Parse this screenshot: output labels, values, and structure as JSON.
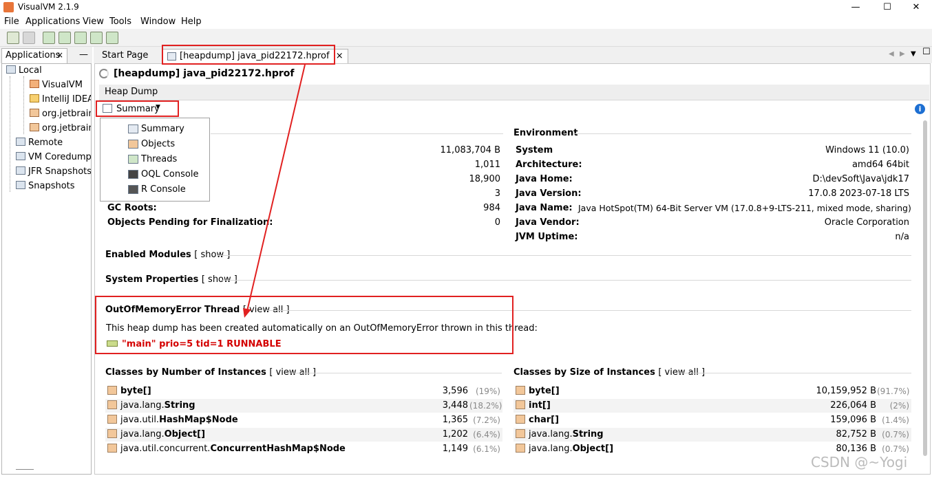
{
  "window": {
    "title": "VisualVM 2.1.9",
    "min": "—",
    "max": "☐",
    "close": "✕"
  },
  "menu": [
    "File",
    "Applications",
    "View",
    "Tools",
    "Window",
    "Help"
  ],
  "left_panel": {
    "tab_label": "Applications",
    "close": "×",
    "minimize": "—",
    "tree": {
      "local": "Local",
      "local_children": [
        "VisualVM",
        "IntelliJ IDEA",
        "org.jetbrains",
        "org.jetbrains"
      ],
      "remote": "Remote",
      "vm_coredumps": "VM Coredumps",
      "jfr_snapshots": "JFR Snapshots",
      "snapshots": "Snapshots"
    }
  },
  "editor_tabs": {
    "start_page": "Start Page",
    "heapdump_tab": "[heapdump] java_pid22172.hprof",
    "close": "×"
  },
  "heapdump": {
    "heading": "[heapdump] java_pid22172.hprof",
    "subheader": "Heap Dump",
    "view_selector": "Summary",
    "info": "i",
    "dropdown": [
      "Summary",
      "Objects",
      "Threads",
      "OQL Console",
      "R Console"
    ]
  },
  "basic_info": {
    "values": [
      "11,083,704 B",
      "1,011",
      "18,900",
      "3"
    ],
    "gc_roots_label": "GC Roots:",
    "gc_roots_value": "984",
    "pending_label": "Objects Pending for Finalization:",
    "pending_value": "0"
  },
  "environment": {
    "title": "Environment",
    "rows": [
      {
        "label": "System",
        "value": "Windows 11 (10.0)"
      },
      {
        "label": "Architecture:",
        "value": "amd64 64bit"
      },
      {
        "label": "Java Home:",
        "value": "D:\\devSoft\\Java\\jdk17"
      },
      {
        "label": "Java Version:",
        "value": "17.0.8 2023-07-18 LTS"
      },
      {
        "label": "Java Name:",
        "value": "Java HotSpot(TM) 64-Bit Server VM (17.0.8+9-LTS-211, mixed mode, sharing)"
      },
      {
        "label": "Java Vendor:",
        "value": "Oracle Corporation"
      },
      {
        "label": "JVM Uptime:",
        "value": "n/a"
      }
    ]
  },
  "sections": {
    "enabled_modules": "Enabled Modules",
    "system_properties": "System Properties",
    "show": "[ show ]",
    "oom_thread": "OutOfMemoryError Thread",
    "view_all": "[ view all ]",
    "oom_text": "This heap dump has been created automatically on an OutOfMemoryError thrown in this thread:",
    "oom_thread_line": "\"main\" prio=5 tid=1 RUNNABLE"
  },
  "classes_by_number": {
    "title": "Classes by Number of Instances",
    "rows": [
      {
        "pkg": "",
        "name": "byte[]",
        "value": "3,596",
        "pct": "(19%)"
      },
      {
        "pkg": "java.lang.",
        "name": "String",
        "value": "3,448",
        "pct": "(18.2%)"
      },
      {
        "pkg": "java.util.",
        "name": "HashMap$Node",
        "value": "1,365",
        "pct": "(7.2%)"
      },
      {
        "pkg": "java.lang.",
        "name": "Object[]",
        "value": "1,202",
        "pct": "(6.4%)"
      },
      {
        "pkg": "java.util.concurrent.",
        "name": "ConcurrentHashMap$Node",
        "value": "1,149",
        "pct": "(6.1%)"
      }
    ]
  },
  "classes_by_size": {
    "title": "Classes by Size of Instances",
    "rows": [
      {
        "pkg": "",
        "name": "byte[]",
        "value": "10,159,952 B",
        "pct": "(91.7%)"
      },
      {
        "pkg": "",
        "name": "int[]",
        "value": "226,064 B",
        "pct": "(2%)"
      },
      {
        "pkg": "",
        "name": "char[]",
        "value": "159,096 B",
        "pct": "(1.4%)"
      },
      {
        "pkg": "java.lang.",
        "name": "String",
        "value": "82,752 B",
        "pct": "(0.7%)"
      },
      {
        "pkg": "java.lang.",
        "name": "Object[]",
        "value": "80,136 B",
        "pct": "(0.7%)"
      }
    ]
  },
  "watermark": "CSDN @~Yogi",
  "colors": {
    "annotation_red": "#e12020",
    "oom_red": "#d40000",
    "info_blue": "#1d6fd2"
  }
}
